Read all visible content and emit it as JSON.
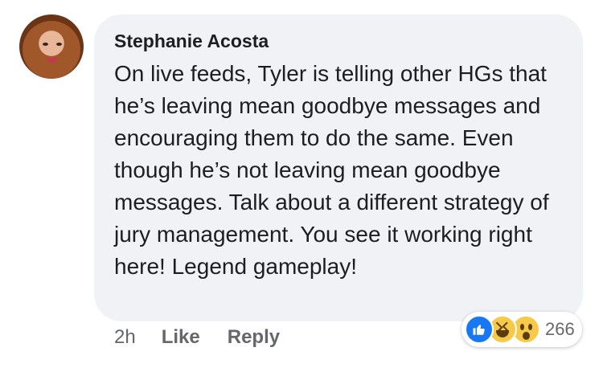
{
  "comment": {
    "author": "Stephanie Acosta",
    "text": "On live feeds, Tyler is telling other HGs that he’s leaving mean goodbye messages and encouraging them to do the same. Even though he’s not leaving mean goodbye messages. Talk about a different strategy of jury management. You see it working right here! Legend gameplay!",
    "time": "2h",
    "like_label": "Like",
    "reply_label": "Reply"
  },
  "reactions": {
    "icons": [
      "like-icon",
      "haha-icon",
      "wow-icon"
    ],
    "count": "266"
  },
  "colors": {
    "bubble": "#f0f2f5",
    "text": "#1c1e21",
    "meta": "#65676b",
    "like_blue": "#1877f2"
  }
}
